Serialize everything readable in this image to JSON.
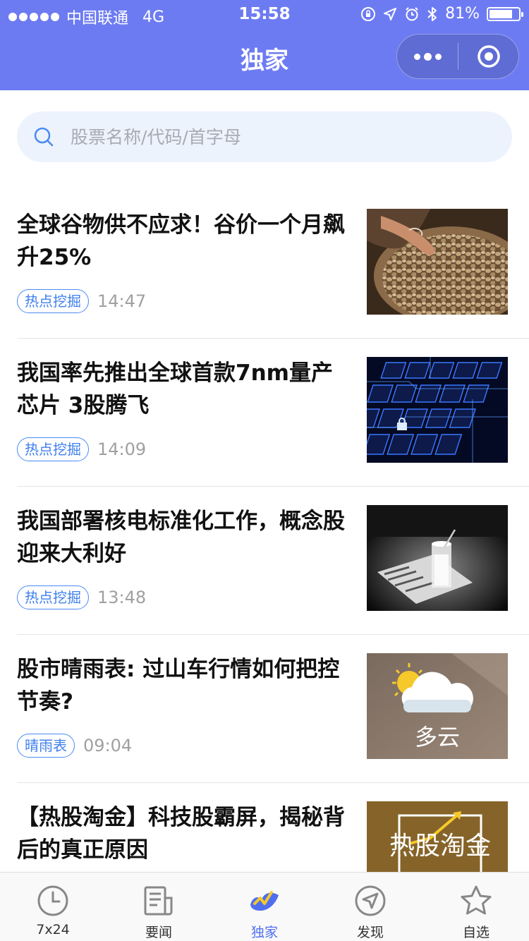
{
  "status_bar": {
    "carrier": "中国联通",
    "network": "4G",
    "time": "15:58",
    "battery": "81%",
    "battery_level": 0.81
  },
  "nav": {
    "title": "独家"
  },
  "search": {
    "placeholder": "股票名称/代码/首字母"
  },
  "news": [
    {
      "title": "全球谷物供不应求！谷价一个月飙升25%",
      "tag": "热点挖掘",
      "time": "14:47",
      "thumb": "grain-photo"
    },
    {
      "title": "我国率先推出全球首款7nm量产芯片 3股腾飞",
      "tag": "热点挖掘",
      "time": "14:09",
      "thumb": "circuit-keyboard-photo"
    },
    {
      "title": "我国部署核电标准化工作，概念股迎来大利好",
      "tag": "热点挖掘",
      "time": "13:48",
      "thumb": "glass-newspaper-photo"
    },
    {
      "title": "股市晴雨表: 过山车行情如何把控节奏?",
      "tag": "晴雨表",
      "time": "09:04",
      "thumb": "weather-card",
      "thumb_text": "多云"
    },
    {
      "title": "【热股淘金】科技股霸屏，揭秘背后的真正原因",
      "tag": "",
      "time": "",
      "thumb": "hot-stock-card",
      "thumb_text": "热股淘金"
    }
  ],
  "tabbar": {
    "tabs": [
      {
        "label": "7x24",
        "icon": "clock-icon"
      },
      {
        "label": "要闻",
        "icon": "news-icon"
      },
      {
        "label": "独家",
        "icon": "exclusive-icon",
        "active": true
      },
      {
        "label": "发现",
        "icon": "compass-icon"
      },
      {
        "label": "自选",
        "icon": "star-icon"
      }
    ]
  },
  "colors": {
    "header": "#6d7bf2",
    "accent": "#4f6ff0",
    "tag": "#3f7fee"
  }
}
